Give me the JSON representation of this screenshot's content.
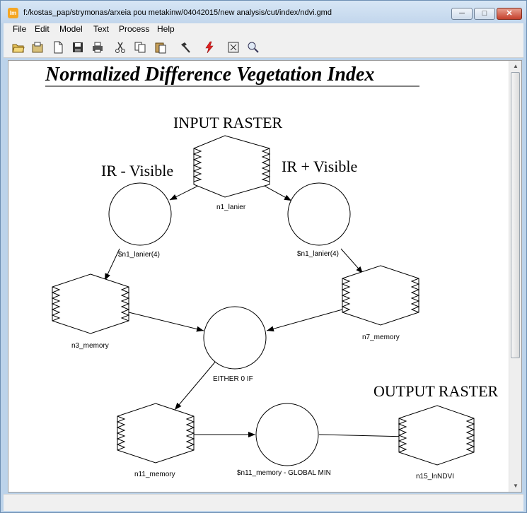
{
  "window": {
    "title": "f:/kostas_pap/strymonas/arxeia pou metakinw/04042015/new analysis/cut/index/ndvi.gmd",
    "app_icon_text": "Im",
    "controls": {
      "minimize": "─",
      "maximize": "□",
      "close": "✕"
    }
  },
  "menu": [
    "File",
    "Edit",
    "Model",
    "Text",
    "Process",
    "Help"
  ],
  "toolbar": {
    "icons": [
      "open-folder-icon",
      "open-model-icon",
      "new-file-icon",
      "save-icon",
      "print-icon",
      "cut-icon",
      "copy-icon",
      "paste-icon",
      "hammer-icon",
      "run-icon",
      "zoom-fit-icon",
      "zoom-icon"
    ]
  },
  "diagram": {
    "title": "Normalized Difference Vegetation Index",
    "annotations": {
      "input_raster": "INPUT RASTER",
      "ir_minus": "IR - Visible",
      "ir_plus": "IR + Visible",
      "output_raster": "OUTPUT RASTER"
    },
    "nodes": {
      "n1": "n1_lanier",
      "f_left": "$n1_lanier(4)",
      "f_right": "$n1_lanier(4)",
      "n3": "n3_memory",
      "n7": "n7_memory",
      "either": "EITHER 0 IF",
      "n11": "n11_memory",
      "global": "$n11_memory - GLOBAL MIN",
      "n15": "n15_lnNDVI"
    }
  },
  "scrollbar": {
    "up": "▲",
    "down": "▼"
  }
}
